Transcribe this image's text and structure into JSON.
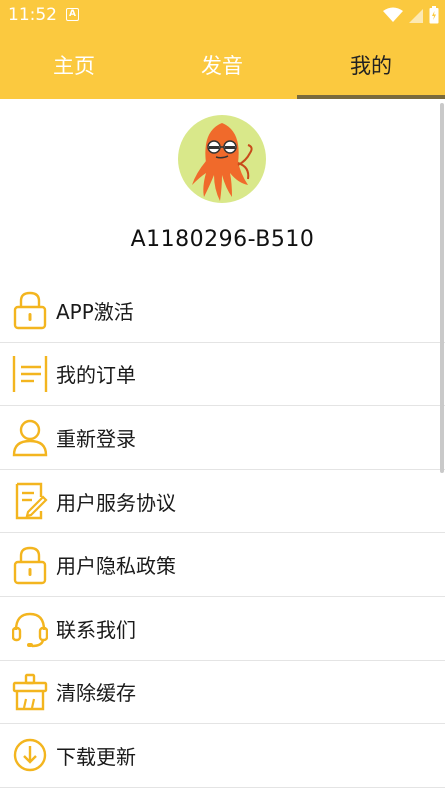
{
  "status_bar": {
    "time": "11:52",
    "notification_letter": "A"
  },
  "tabs": [
    {
      "label": "主页",
      "active": false
    },
    {
      "label": "发音",
      "active": false
    },
    {
      "label": "我的",
      "active": true
    }
  ],
  "profile": {
    "user_id": "A1180296-B510",
    "avatar_icon": "squid-mascot-icon"
  },
  "menu": [
    {
      "label": "APP激活",
      "icon": "lock-icon"
    },
    {
      "label": "我的订单",
      "icon": "order-list-icon"
    },
    {
      "label": "重新登录",
      "icon": "user-icon"
    },
    {
      "label": "用户服务协议",
      "icon": "document-edit-icon"
    },
    {
      "label": "用户隐私政策",
      "icon": "lock-icon"
    },
    {
      "label": "联系我们",
      "icon": "headset-icon"
    },
    {
      "label": "清除缓存",
      "icon": "clean-basket-icon"
    },
    {
      "label": "下载更新",
      "icon": "download-icon"
    }
  ],
  "colors": {
    "accent": "#fbc93f",
    "icon": "#f3b51f",
    "text": "#1a1a1a"
  }
}
